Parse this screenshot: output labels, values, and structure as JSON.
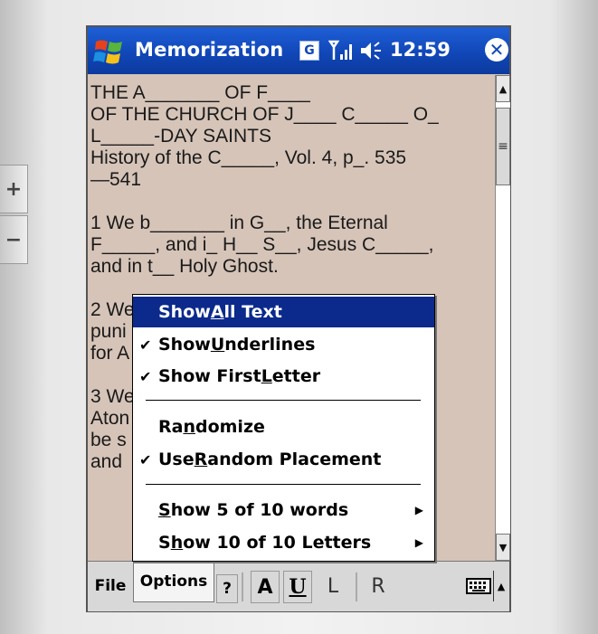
{
  "titlebar": {
    "start_icon": "windows-flag-icon",
    "title": "Memorization",
    "g_label": "G",
    "signal_icon": "signal-strength-icon",
    "volume_icon": "speaker-icon",
    "clock": "12:59",
    "close_glyph": "✕"
  },
  "document": {
    "lines": [
      "THE A_______ OF F____",
      "OF THE CHURCH OF J____ C_____ O_",
      "L_____-DAY SAINTS",
      "History of the C_____, Vol. 4, p_. 535",
      "—541",
      "",
      "1 We b_______ in G__, the Eternal",
      "F_____, and i_ H__ S__, Jesus C_____,",
      "and in t__ Holy Ghost.",
      "",
      "2 We",
      "puni                              n__",
      "for A",
      "",
      "3 We",
      "Aton                              d may",
      "be s                              ___",
      "and"
    ]
  },
  "scrollbar": {
    "up_glyph": "▲",
    "down_glyph": "▼",
    "thumb_glyph": "≡"
  },
  "menubar": {
    "file": "File",
    "options": "Options",
    "help": "?",
    "tool_a": "A",
    "tool_u": "U",
    "tool_l": "L",
    "tool_r": "R",
    "keyboard_icon": "keyboard-icon",
    "sip_arrow": "▲"
  },
  "popup": {
    "show_all_text": {
      "pre": "Show ",
      "key": "A",
      "post": "ll Text"
    },
    "show_underlines": {
      "pre": "Show ",
      "key": "U",
      "post": "nderlines",
      "checked": true
    },
    "show_first_letter": {
      "pre": "Show First ",
      "key": "L",
      "post": "etter",
      "checked": true
    },
    "randomize": {
      "pre": "Ra",
      "key": "n",
      "post": "domize"
    },
    "use_random_placement": {
      "pre": "Use ",
      "key": "R",
      "post": "andom Placement",
      "checked": true
    },
    "show_words": {
      "pre": "",
      "key": "S",
      "post": "how 5 of 10 words"
    },
    "show_letters": {
      "pre": "S",
      "key": "h",
      "post": "ow 10 of 10 Letters"
    },
    "check_glyph": "✔",
    "submenu_glyph": "▶"
  },
  "colors": {
    "titlebar": "#1147b8",
    "document_bg": "#d6c4b8",
    "selection": "#0b2a8c"
  }
}
